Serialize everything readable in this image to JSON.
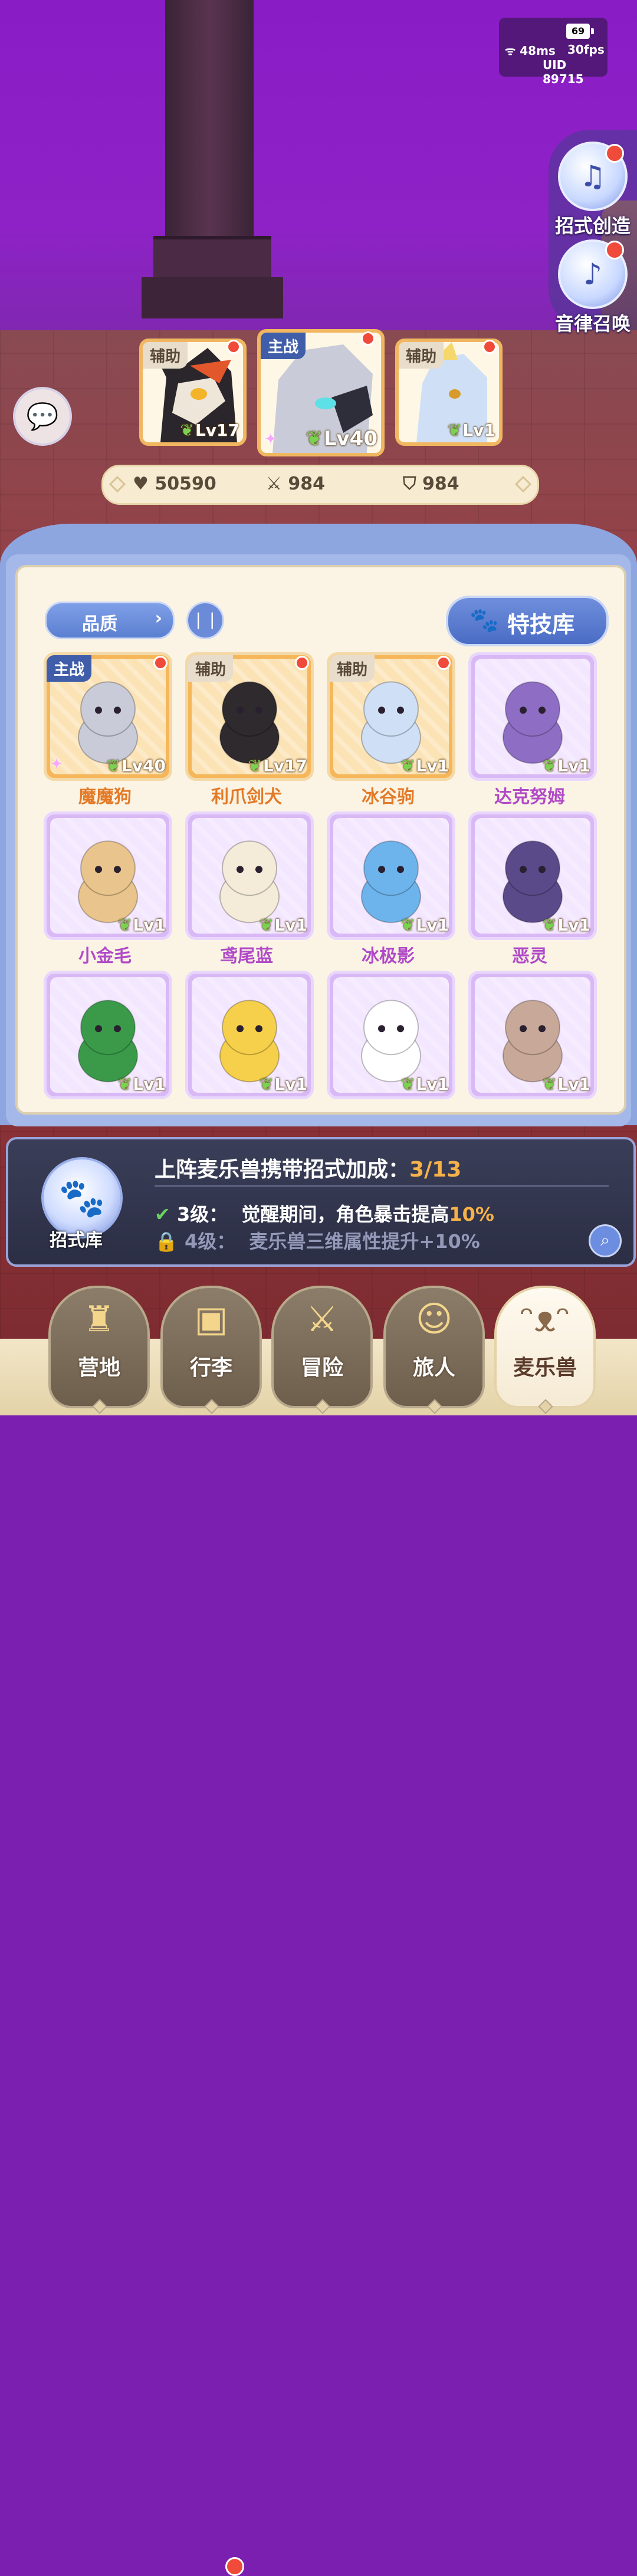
{
  "status": {
    "battery": "69",
    "ping": "48ms",
    "fps": "30fps",
    "uid": "UID 89715"
  },
  "side_menu": [
    {
      "label": "招式创造",
      "icon": "music-book-icon"
    },
    {
      "label": "音律召唤",
      "icon": "lyre-icon"
    }
  ],
  "team": [
    {
      "tag": "辅助",
      "level": "Lv17"
    },
    {
      "tag": "主战",
      "level": "Lv40"
    },
    {
      "tag": "辅助",
      "level": "Lv1"
    }
  ],
  "stats": {
    "hp": "50590",
    "attack": "984",
    "defense": "984"
  },
  "toolbar": {
    "quality": "品质",
    "skill_library": "特技库"
  },
  "pets": [
    {
      "name": "魔魔狗",
      "level": "Lv40",
      "tag": "主战",
      "rarity": "gold",
      "color": "#c9ccd8"
    },
    {
      "name": "利爪剑犬",
      "level": "Lv17",
      "tag": "辅助",
      "rarity": "gold",
      "color": "#2e2a2e"
    },
    {
      "name": "冰谷驹",
      "level": "Lv1",
      "tag": "辅助",
      "rarity": "gold",
      "color": "#cfe0f6"
    },
    {
      "name": "达克努姆",
      "level": "Lv1",
      "tag": "",
      "rarity": "purple",
      "color": "#8e6ec4"
    },
    {
      "name": "小金毛",
      "level": "Lv1",
      "tag": "",
      "rarity": "purple",
      "color": "#e9c48c"
    },
    {
      "name": "鸢尾蓝",
      "level": "Lv1",
      "tag": "",
      "rarity": "purple",
      "color": "#f4ecd8"
    },
    {
      "name": "冰极影",
      "level": "Lv1",
      "tag": "",
      "rarity": "purple",
      "color": "#6eb4ec"
    },
    {
      "name": "恶灵",
      "level": "Lv1",
      "tag": "",
      "rarity": "purple",
      "color": "#5a4a8a"
    },
    {
      "name": "",
      "level": "Lv1",
      "tag": "",
      "rarity": "purple",
      "color": "#3a9a4a"
    },
    {
      "name": "",
      "level": "Lv1",
      "tag": "",
      "rarity": "purple",
      "color": "#f6d04a"
    },
    {
      "name": "",
      "level": "Lv1",
      "tag": "",
      "rarity": "purple",
      "color": "#ffffff"
    },
    {
      "name": "",
      "level": "Lv1",
      "tag": "",
      "rarity": "purple",
      "color": "#c8a898"
    }
  ],
  "bonus": {
    "icon_label": "招式库",
    "title": "上阵麦乐兽携带招式加成：",
    "progress": "3/13",
    "line1_level": "3级：",
    "line1_text": "觉醒期间，角色暴击提高",
    "line1_pct": "10%",
    "line2_level": "4级：",
    "line2_text": "麦乐兽三维属性提升+10%"
  },
  "nav": [
    {
      "label": "营地",
      "icon": "castle-icon",
      "active": false
    },
    {
      "label": "行李",
      "icon": "bag-icon",
      "active": false
    },
    {
      "label": "冒险",
      "icon": "crossed-swords-icon",
      "active": false
    },
    {
      "label": "旅人",
      "icon": "traveler-icon",
      "active": false
    },
    {
      "label": "麦乐兽",
      "icon": "pet-icon",
      "active": true
    }
  ]
}
